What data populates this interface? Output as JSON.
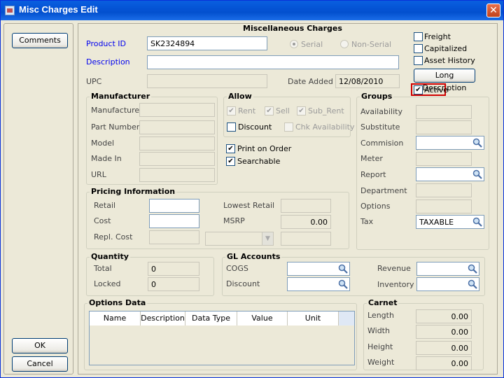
{
  "window": {
    "title": "Misc Charges Edit"
  },
  "side": {
    "comments_label": "Comments",
    "ok_label": "OK",
    "cancel_label": "Cancel"
  },
  "header": {
    "section_title": "Miscellaneous Charges",
    "product_id_label": "Product ID",
    "product_id_value": "SK2324894",
    "serial_label": "Serial",
    "non_serial_label": "Non-Serial",
    "description_label": "Description",
    "description_value": "",
    "upc_label": "UPC",
    "upc_value": "",
    "date_added_label": "Date Added",
    "date_added_value": "12/08/2010"
  },
  "flags": {
    "freight": "Freight",
    "capitalized": "Capitalized",
    "asset_history": "Asset History",
    "long_description": "Long Description",
    "active": "Active"
  },
  "manufacturer": {
    "title": "Manufacturer",
    "fields": [
      "Manufacturer",
      "Part Number",
      "Model",
      "Made In",
      "URL"
    ]
  },
  "allow": {
    "title": "Allow",
    "rent": "Rent",
    "sell": "Sell",
    "sub_rent": "Sub_Rent",
    "discount": "Discount",
    "chk_availability": "Chk Availability",
    "print_on_order": "Print on Order",
    "searchable": "Searchable"
  },
  "groups": {
    "title": "Groups",
    "fields": [
      "Availability",
      "Substitute",
      "Commision",
      "Meter",
      "Report",
      "Department",
      "Options",
      "Tax"
    ],
    "tax_value": "TAXABLE"
  },
  "pricing": {
    "title": "Pricing Information",
    "retail": "Retail",
    "cost": "Cost",
    "repl_cost": "Repl. Cost",
    "lowest_retail": "Lowest Retail",
    "msrp": "MSRP",
    "msrp_value": "0.00"
  },
  "quantity": {
    "title": "Quantity",
    "total": "Total",
    "total_value": "0",
    "locked": "Locked",
    "locked_value": "0"
  },
  "gl": {
    "title": "GL Accounts",
    "cogs": "COGS",
    "discount": "Discount",
    "revenue": "Revenue",
    "inventory": "Inventory"
  },
  "options": {
    "title": "Options Data",
    "columns": [
      "Name",
      "Description",
      "Data Type",
      "Value",
      "Unit"
    ]
  },
  "carnet": {
    "title": "Carnet",
    "length": "Length",
    "width": "Width",
    "height": "Height",
    "weight": "Weight",
    "length_value": "0.00",
    "width_value": "0.00",
    "height_value": "0.00",
    "weight_value": "0.00"
  }
}
